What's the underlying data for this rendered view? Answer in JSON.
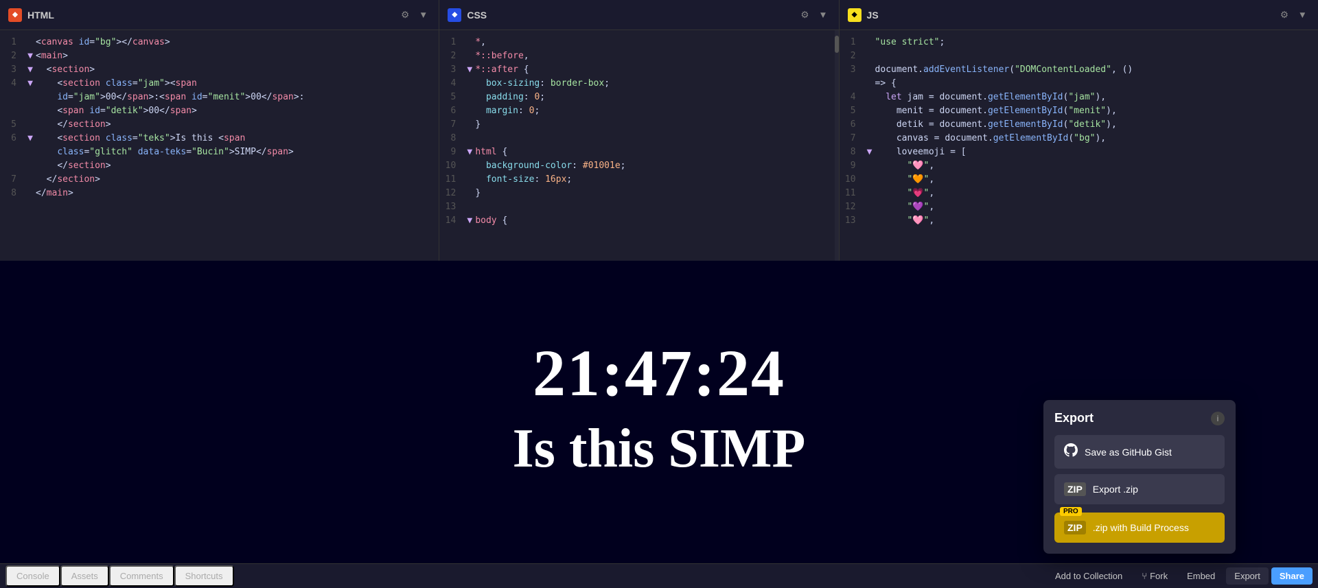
{
  "editor": {
    "panels": [
      {
        "id": "html",
        "lang": "HTML",
        "langClass": "html",
        "langSymbol": "◆",
        "lines": [
          {
            "num": 1,
            "arrow": "",
            "code": "<span class='t-punct'>&lt;</span><span class='t-tag'>canvas</span> <span class='t-attr'>id</span><span class='t-punct'>=</span><span class='t-str'>\"bg\"</span><span class='t-punct'>&gt;&lt;/</span><span class='t-tag'>canvas</span><span class='t-punct'>&gt;</span>"
          },
          {
            "num": 2,
            "arrow": "▼",
            "code": "<span class='t-punct'>&lt;</span><span class='t-tag'>main</span><span class='t-punct'>&gt;</span>"
          },
          {
            "num": 3,
            "arrow": "▼",
            "code": "  <span class='t-punct'>&lt;</span><span class='t-tag'>section</span><span class='t-punct'>&gt;</span>"
          },
          {
            "num": 4,
            "arrow": "▼",
            "code": "    <span class='t-punct'>&lt;</span><span class='t-tag'>section</span> <span class='t-attr'>class</span><span class='t-punct'>=</span><span class='t-str'>\"jam\"</span><span class='t-punct'>&gt;&lt;</span><span class='t-tag'>span</span>"
          },
          {
            "num": "",
            "arrow": "",
            "code": "    <span class='t-attr'>id</span><span class='t-punct'>=</span><span class='t-str'>\"jam\"</span><span class='t-punct'>&gt;</span>00<span class='t-punct'>&lt;/</span><span class='t-tag'>span</span><span class='t-punct'>&gt;:&lt;</span><span class='t-tag'>span</span> <span class='t-attr'>id</span><span class='t-punct'>=</span><span class='t-str'>\"menit\"</span><span class='t-punct'>&gt;</span>00<span class='t-punct'>&lt;/</span><span class='t-tag'>span</span><span class='t-punct'>&gt;:</span>"
          },
          {
            "num": "",
            "arrow": "",
            "code": "    <span class='t-punct'>&lt;</span><span class='t-tag'>span</span> <span class='t-attr'>id</span><span class='t-punct'>=</span><span class='t-str'>\"detik\"</span><span class='t-punct'>&gt;</span>00<span class='t-punct'>&lt;/</span><span class='t-tag'>span</span><span class='t-punct'>&gt;</span>"
          },
          {
            "num": 5,
            "arrow": "",
            "code": "    <span class='t-punct'>&lt;/</span><span class='t-tag'>section</span><span class='t-punct'>&gt;</span>"
          },
          {
            "num": 6,
            "arrow": "▼",
            "code": "    <span class='t-punct'>&lt;</span><span class='t-tag'>section</span> <span class='t-attr'>class</span><span class='t-punct'>=</span><span class='t-str'>\"teks\"</span><span class='t-punct'>&gt;</span>Is this <span class='t-punct'>&lt;</span><span class='t-tag'>span</span>"
          },
          {
            "num": "",
            "arrow": "",
            "code": "    <span class='t-attr'>class</span><span class='t-punct'>=</span><span class='t-str'>\"glitch\"</span> <span class='t-attr'>data-teks</span><span class='t-punct'>=</span><span class='t-str'>\"Bucin\"</span><span class='t-punct'>&gt;</span>SIMP<span class='t-punct'>&lt;/</span><span class='t-tag'>span</span><span class='t-punct'>&gt;</span>"
          },
          {
            "num": "",
            "arrow": "",
            "code": "    <span class='t-punct'>&lt;/</span><span class='t-tag'>section</span><span class='t-punct'>&gt;</span>"
          },
          {
            "num": 7,
            "arrow": "",
            "code": "  <span class='t-punct'>&lt;/</span><span class='t-tag'>section</span><span class='t-punct'>&gt;</span>"
          },
          {
            "num": 8,
            "arrow": "",
            "code": "<span class='t-punct'>&lt;/</span><span class='t-tag'>main</span><span class='t-punct'>&gt;</span>"
          }
        ]
      },
      {
        "id": "css",
        "lang": "CSS",
        "langClass": "css",
        "langSymbol": "◆",
        "lines": [
          {
            "num": 1,
            "arrow": "",
            "code": "<span class='t-tag'>*</span>,"
          },
          {
            "num": 2,
            "arrow": "",
            "code": "<span class='t-tag'>*::before</span>,"
          },
          {
            "num": 3,
            "arrow": "▼",
            "code": "<span class='t-tag'>*::after</span> <span class='t-punct'>{</span>"
          },
          {
            "num": 4,
            "arrow": "",
            "code": "  <span class='t-prop'>box-sizing</span>: <span class='t-val'>border-box</span>;"
          },
          {
            "num": 5,
            "arrow": "",
            "code": "  <span class='t-prop'>padding</span>: <span class='t-num'>0</span>;"
          },
          {
            "num": 6,
            "arrow": "",
            "code": "  <span class='t-prop'>margin</span>: <span class='t-num'>0</span>;"
          },
          {
            "num": 7,
            "arrow": "",
            "code": "<span class='t-punct'>}</span>"
          },
          {
            "num": 8,
            "arrow": "",
            "code": ""
          },
          {
            "num": 9,
            "arrow": "▼",
            "code": "<span class='t-tag'>html</span> <span class='t-punct'>{</span>"
          },
          {
            "num": 10,
            "arrow": "",
            "code": "  <span class='t-prop'>background-color</span>: <span class='t-num'>#01001e</span>;"
          },
          {
            "num": 11,
            "arrow": "",
            "code": "  <span class='t-prop'>font-size</span>: <span class='t-num'>16px</span>;"
          },
          {
            "num": 12,
            "arrow": "",
            "code": "<span class='t-punct'>}</span>"
          },
          {
            "num": 13,
            "arrow": "",
            "code": ""
          },
          {
            "num": 14,
            "arrow": "▼",
            "code": "<span class='t-tag'>body</span> <span class='t-punct'>{</span>"
          }
        ]
      },
      {
        "id": "js",
        "lang": "JS",
        "langClass": "js",
        "langSymbol": "◆",
        "lines": [
          {
            "num": 1,
            "arrow": "",
            "code": "<span class='t-str'>\"use strict\"</span>;"
          },
          {
            "num": 2,
            "arrow": "",
            "code": ""
          },
          {
            "num": 3,
            "arrow": "",
            "code": "<span class='t-id'>document</span>.<span class='t-fn'>addEventListener</span>(<span class='t-str'>\"DOMContentLoaded\"</span>, ()"
          },
          {
            "num": "",
            "arrow": "",
            "code": "=&gt; <span class='t-punct'>{</span>"
          },
          {
            "num": 4,
            "arrow": "",
            "code": "  <span class='t-kw'>let</span> <span class='t-id'>jam</span> = <span class='t-id'>document</span>.<span class='t-fn'>getElementById</span>(<span class='t-str'>\"jam\"</span>),"
          },
          {
            "num": 5,
            "arrow": "",
            "code": "    <span class='t-id'>menit</span> = <span class='t-id'>document</span>.<span class='t-fn'>getElementById</span>(<span class='t-str'>\"menit\"</span>),"
          },
          {
            "num": 6,
            "arrow": "",
            "code": "    <span class='t-id'>detik</span> = <span class='t-id'>document</span>.<span class='t-fn'>getElementById</span>(<span class='t-str'>\"detik\"</span>),"
          },
          {
            "num": 7,
            "arrow": "",
            "code": "    <span class='t-id'>canvas</span> = <span class='t-id'>document</span>.<span class='t-fn'>getElementById</span>(<span class='t-str'>\"bg\"</span>),"
          },
          {
            "num": 8,
            "arrow": "▼",
            "code": "    <span class='t-id'>loveemoji</span> = <span class='t-punct'>[</span>"
          },
          {
            "num": 9,
            "arrow": "",
            "code": "      <span class='t-str'>\"🩷\"</span>,"
          },
          {
            "num": 10,
            "arrow": "",
            "code": "      <span class='t-str'>\"🧡\"</span>,"
          },
          {
            "num": 11,
            "arrow": "",
            "code": "      <span class='t-str'>\"💗\"</span>,"
          },
          {
            "num": 12,
            "arrow": "",
            "code": "      <span class='t-str'>\"💜\"</span>,"
          },
          {
            "num": 13,
            "arrow": "",
            "code": "      <span class='t-str'>\"🩷\"</span>,"
          }
        ]
      }
    ]
  },
  "preview": {
    "time": "21:47:24",
    "text": "Is this SIMP"
  },
  "bottom_tabs": [
    {
      "id": "console",
      "label": "Console"
    },
    {
      "id": "assets",
      "label": "Assets"
    },
    {
      "id": "comments",
      "label": "Comments"
    },
    {
      "id": "shortcuts",
      "label": "Shortcuts"
    }
  ],
  "bottom_right_btns": [
    {
      "id": "add-to-collection",
      "label": "Add to Collection"
    },
    {
      "id": "fork",
      "label": "Fork",
      "icon": "⑂"
    },
    {
      "id": "embed",
      "label": "Embed"
    },
    {
      "id": "export",
      "label": "Export"
    },
    {
      "id": "share",
      "label": "Share"
    }
  ],
  "export_panel": {
    "title": "Export",
    "info_icon": "i",
    "buttons": [
      {
        "id": "github-gist",
        "label": "Save as GitHub Gist",
        "icon": "github",
        "pro": false
      },
      {
        "id": "export-zip",
        "label": "Export .zip",
        "icon": "zip",
        "pro": false
      },
      {
        "id": "zip-build",
        "label": ".zip with Build Process",
        "icon": "zip",
        "pro": true,
        "pro_label": "PRO"
      }
    ]
  },
  "colors": {
    "bg_dark": "#01001e",
    "editor_bg": "#1e1e2e",
    "header_bg": "#1a1a2e",
    "panel_bg": "#2a2a3e",
    "accent": "#4a9eff",
    "pro_yellow": "#c8a000",
    "pro_badge_bg": "#ffcc00"
  }
}
